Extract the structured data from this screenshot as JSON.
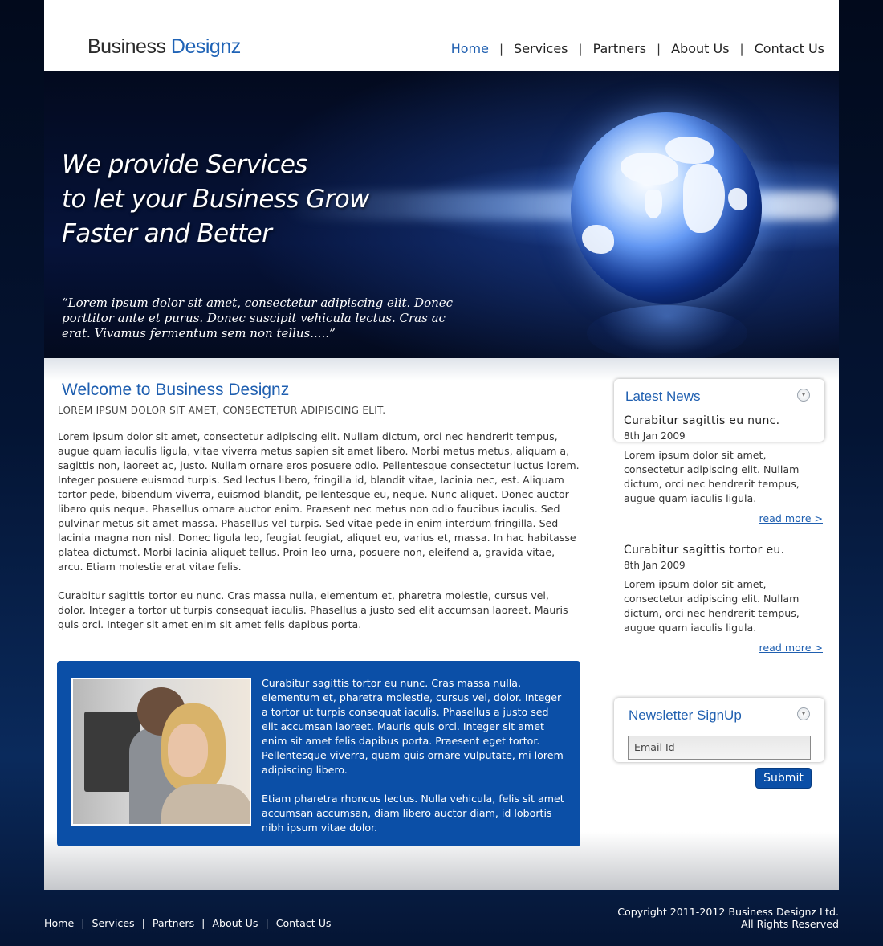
{
  "brand": {
    "name_part1": "Business",
    "name_part2": "Designz"
  },
  "nav": {
    "items": [
      {
        "label": "Home"
      },
      {
        "label": "Services"
      },
      {
        "label": "Partners"
      },
      {
        "label": "About Us"
      },
      {
        "label": "Contact Us"
      }
    ],
    "active": "Home",
    "separator": "|"
  },
  "banner": {
    "headline_lines": [
      "We provide Services",
      "to let your Business Grow",
      "Faster and Better"
    ],
    "quote": "“Lorem ipsum dolor sit amet, consectetur adipiscing elit. Donec porttitor ante et purus. Donec suscipit vehicula lectus. Cras ac erat. Vivamus fermentum sem non tellus.....”"
  },
  "welcome": {
    "title": "Welcome to Business Designz",
    "subtitle": "LOREM IPSUM DOLOR SIT AMET, CONSECTETUR ADIPISCING ELIT.",
    "paragraphs": [
      "Lorem ipsum dolor sit amet, consectetur adipiscing elit. Nullam dictum, orci nec hendrerit tempus, augue quam iaculis ligula, vitae viverra metus sapien sit amet libero. Morbi metus metus, aliquam a, sagittis non, laoreet ac, justo. Nullam ornare eros posuere odio. Pellentesque consectetur luctus lorem. Integer posuere euismod turpis. Sed lectus libero, fringilla id, blandit vitae, lacinia nec, est. Aliquam tortor pede, bibendum viverra, euismod blandit, pellentesque eu, neque. Nunc aliquet. Donec auctor libero quis neque. Phasellus ornare auctor enim. Praesent nec metus non odio faucibus iaculis. Sed pulvinar metus sit amet massa. Phasellus vel turpis. Sed vitae pede in enim interdum fringilla. Sed lacinia magna non nisl. Donec ligula leo, feugiat feugiat, aliquet eu, varius et, massa. In hac habitasse platea dictumst. Morbi lacinia aliquet tellus. Proin leo urna, posuere non, eleifend a, gravida vitae, arcu. Etiam molestie erat vitae felis.",
      "Curabitur sagittis tortor eu nunc. Cras massa nulla, elementum et, pharetra molestie, cursus vel, dolor. Integer a tortor ut turpis consequat iaculis. Phasellus a justo sed elit accumsan laoreet. Mauris quis orci. Integer sit amet enim sit amet felis dapibus porta."
    ]
  },
  "feature": {
    "paragraphs": [
      "Curabitur sagittis tortor eu nunc. Cras massa nulla, elementum et, pharetra molestie, cursus vel, dolor. Integer a tortor ut turpis consequat iaculis. Phasellus a justo sed elit accumsan laoreet. Mauris quis orci. Integer sit amet enim sit amet felis dapibus porta. Praesent eget tortor. Pellentesque viverra, quam quis ornare vulputate, mi lorem adipiscing libero.",
      "Etiam pharetra rhoncus lectus. Nulla vehicula, felis sit amet accumsan accumsan, diam libero auctor diam, id lobortis nibh ipsum vitae dolor."
    ]
  },
  "news": {
    "title": "Latest News",
    "items": [
      {
        "title": "Curabitur sagittis eu nunc.",
        "date": "8th Jan 2009",
        "body": "Lorem ipsum dolor sit amet, consectetur adipiscing elit. Nullam dictum, orci nec hendrerit tempus, augue quam iaculis ligula.",
        "more": "read more >"
      },
      {
        "title": "Curabitur sagittis tortor eu.",
        "date": "8th Jan 2009",
        "body": "Lorem ipsum dolor sit amet, consectetur adipiscing elit. Nullam dictum, orci nec hendrerit tempus, augue quam iaculis ligula.",
        "more": "read more >"
      }
    ]
  },
  "newsletter": {
    "title": "Newsletter SignUp",
    "email_placeholder": "Email Id",
    "submit_label": "Submit"
  },
  "footer": {
    "nav": [
      "Home",
      "Services",
      "Partners",
      "About Us",
      "Contact Us"
    ],
    "copyright": "Copyright 2011-2012 Business Designz Ltd.",
    "rights": "All Rights Reserved"
  },
  "colors": {
    "accent": "#1f5fb0",
    "feature_box": "#0b4fa7",
    "page_bg": "#041433"
  },
  "icons": {
    "panel_toggle": "chevron-down-circle-icon"
  }
}
